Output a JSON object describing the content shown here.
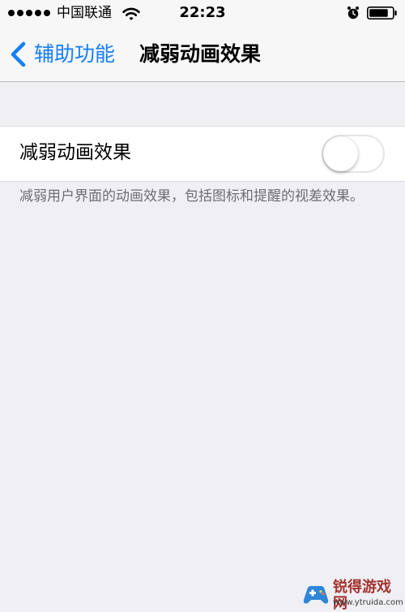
{
  "status_bar": {
    "carrier": "中国联通",
    "time": "22:23"
  },
  "nav": {
    "back_label": "辅助功能",
    "title": "减弱动画效果"
  },
  "settings": {
    "reduce_motion_label": "减弱动画效果",
    "reduce_motion_enabled": false,
    "footnote": "减弱用户界面的动画效果，包括图标和提醒的视差效果。"
  },
  "watermark": {
    "name": "锐得游戏网",
    "url": "www.ytruida.com"
  },
  "icons": {
    "signal": "signal-dots-icon",
    "wifi": "wifi-icon",
    "alarm": "alarm-icon",
    "battery": "battery-icon",
    "back": "chevron-left-icon"
  },
  "colors": {
    "accent": "#157efb",
    "background": "#efeff4",
    "footnote_text": "#6d6d72"
  }
}
